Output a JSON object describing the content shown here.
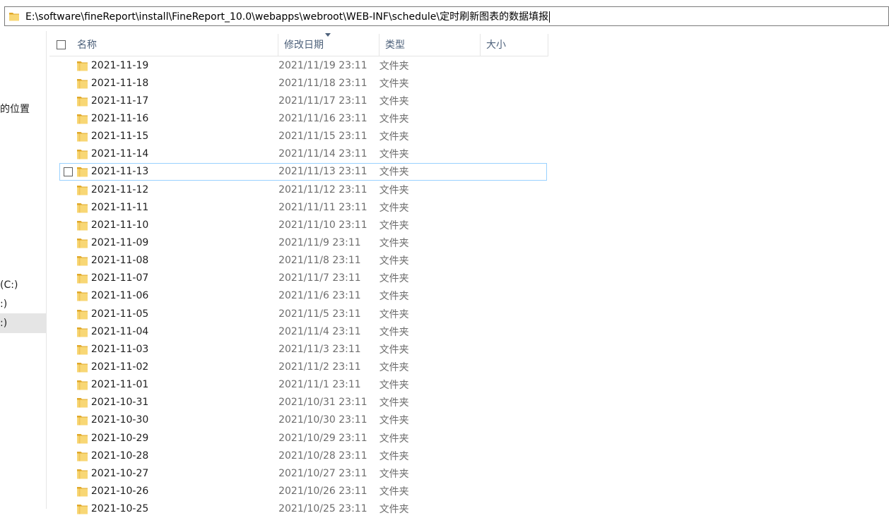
{
  "address_bar": {
    "path": "E:\\software\\fineReport\\install\\FineReport_10.0\\webapps\\webroot\\WEB-INF\\schedule\\定时刷新图表的数据填报"
  },
  "sidebar": {
    "items": [
      {
        "label": "的位置"
      },
      {
        "label": "(C:)"
      },
      {
        "label": ":)"
      },
      {
        "label": ":)"
      }
    ]
  },
  "columns": {
    "name": "名称",
    "date": "修改日期",
    "type": "类型",
    "size": "大小"
  },
  "files": [
    {
      "name": "2021-11-19",
      "date": "2021/11/19 23:11",
      "type": "文件夹",
      "size": ""
    },
    {
      "name": "2021-11-18",
      "date": "2021/11/18 23:11",
      "type": "文件夹",
      "size": ""
    },
    {
      "name": "2021-11-17",
      "date": "2021/11/17 23:11",
      "type": "文件夹",
      "size": ""
    },
    {
      "name": "2021-11-16",
      "date": "2021/11/16 23:11",
      "type": "文件夹",
      "size": ""
    },
    {
      "name": "2021-11-15",
      "date": "2021/11/15 23:11",
      "type": "文件夹",
      "size": ""
    },
    {
      "name": "2021-11-14",
      "date": "2021/11/14 23:11",
      "type": "文件夹",
      "size": ""
    },
    {
      "name": "2021-11-13",
      "date": "2021/11/13 23:11",
      "type": "文件夹",
      "size": ""
    },
    {
      "name": "2021-11-12",
      "date": "2021/11/12 23:11",
      "type": "文件夹",
      "size": ""
    },
    {
      "name": "2021-11-11",
      "date": "2021/11/11 23:11",
      "type": "文件夹",
      "size": ""
    },
    {
      "name": "2021-11-10",
      "date": "2021/11/10 23:11",
      "type": "文件夹",
      "size": ""
    },
    {
      "name": "2021-11-09",
      "date": "2021/11/9 23:11",
      "type": "文件夹",
      "size": ""
    },
    {
      "name": "2021-11-08",
      "date": "2021/11/8 23:11",
      "type": "文件夹",
      "size": ""
    },
    {
      "name": "2021-11-07",
      "date": "2021/11/7 23:11",
      "type": "文件夹",
      "size": ""
    },
    {
      "name": "2021-11-06",
      "date": "2021/11/6 23:11",
      "type": "文件夹",
      "size": ""
    },
    {
      "name": "2021-11-05",
      "date": "2021/11/5 23:11",
      "type": "文件夹",
      "size": ""
    },
    {
      "name": "2021-11-04",
      "date": "2021/11/4 23:11",
      "type": "文件夹",
      "size": ""
    },
    {
      "name": "2021-11-03",
      "date": "2021/11/3 23:11",
      "type": "文件夹",
      "size": ""
    },
    {
      "name": "2021-11-02",
      "date": "2021/11/2 23:11",
      "type": "文件夹",
      "size": ""
    },
    {
      "name": "2021-11-01",
      "date": "2021/11/1 23:11",
      "type": "文件夹",
      "size": ""
    },
    {
      "name": "2021-10-31",
      "date": "2021/10/31 23:11",
      "type": "文件夹",
      "size": ""
    },
    {
      "name": "2021-10-30",
      "date": "2021/10/30 23:11",
      "type": "文件夹",
      "size": ""
    },
    {
      "name": "2021-10-29",
      "date": "2021/10/29 23:11",
      "type": "文件夹",
      "size": ""
    },
    {
      "name": "2021-10-28",
      "date": "2021/10/28 23:11",
      "type": "文件夹",
      "size": ""
    },
    {
      "name": "2021-10-27",
      "date": "2021/10/27 23:11",
      "type": "文件夹",
      "size": ""
    },
    {
      "name": "2021-10-26",
      "date": "2021/10/26 23:11",
      "type": "文件夹",
      "size": ""
    },
    {
      "name": "2021-10-25",
      "date": "2021/10/25 23:11",
      "type": "文件夹",
      "size": ""
    }
  ],
  "colors": {
    "folder_yellow": "#f8d775",
    "folder_dark": "#e0a829",
    "hover_border": "#99d1ff",
    "header_text": "#4c607a"
  }
}
